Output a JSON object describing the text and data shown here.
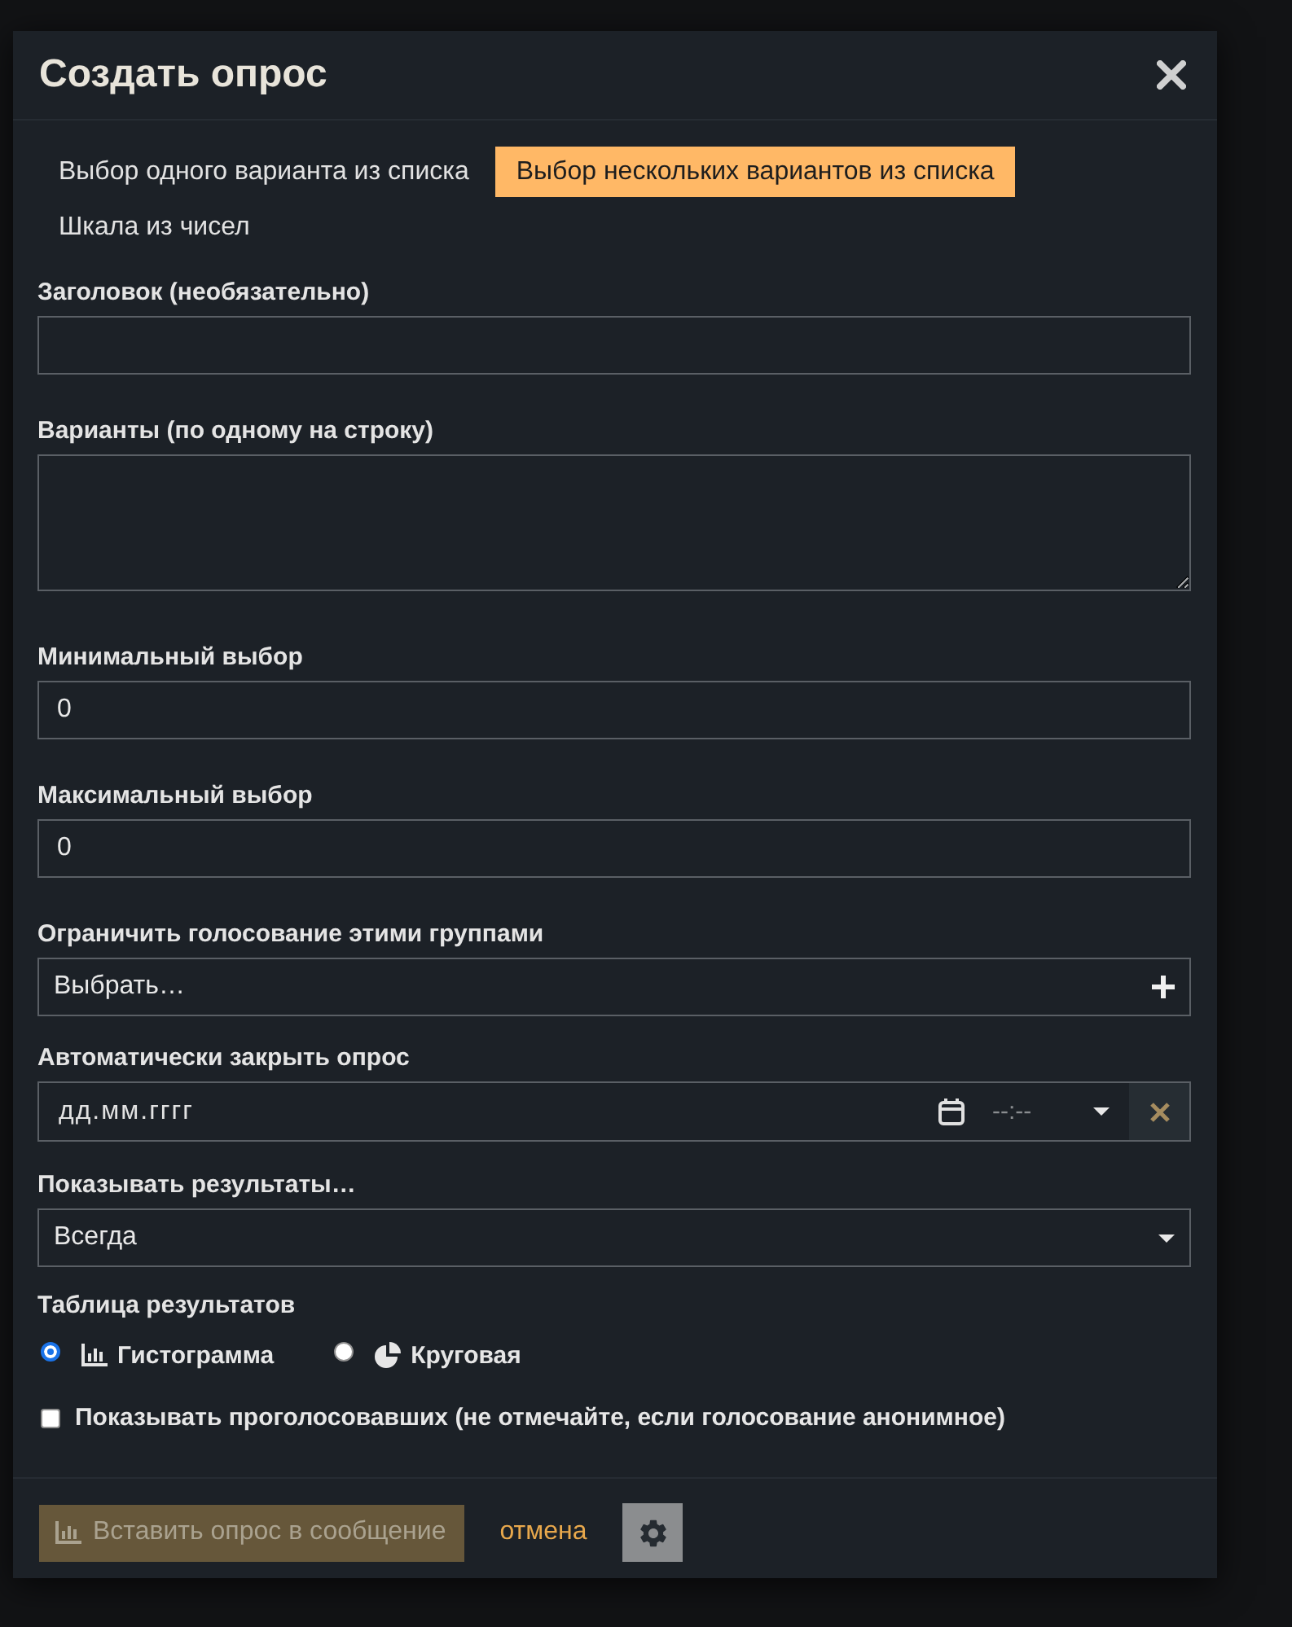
{
  "dialog": {
    "title": "Создать опрос"
  },
  "poll_types": [
    {
      "label": "Выбор одного варианта из списка",
      "selected": false
    },
    {
      "label": "Выбор нескольких вариантов из списка",
      "selected": true
    },
    {
      "label": "Шкала из чисел",
      "selected": false
    }
  ],
  "fields": [
    {
      "kind": "text",
      "label": "Заголовок (необязательно)"
    },
    {
      "kind": "textarea",
      "label": "Варианты (по одному на строку)"
    },
    {
      "kind": "number",
      "label": "Минимальный выбор",
      "value": "0"
    },
    {
      "kind": "number",
      "label": "Максимальный выбор",
      "value": "0"
    },
    {
      "kind": "picker",
      "label": "Ограничить голосование этими группами",
      "placeholder": "Выбрать…"
    },
    {
      "kind": "datetime",
      "label": "Автоматически закрыть опрос",
      "date": {
        "placeholder": "дд.мм.гггг"
      },
      "time": {
        "placeholder": "--:--"
      }
    },
    {
      "kind": "select",
      "label": "Показывать результаты…",
      "value": "Всегда"
    }
  ],
  "chart_type": {
    "label": "Таблица результатов",
    "options": [
      {
        "kind": "bar",
        "label": "Гистограмма",
        "selected": true
      },
      {
        "kind": "pie",
        "label": "Круговая",
        "selected": false
      }
    ]
  },
  "show_voters": {
    "label": "Показывать проголосовавших (не отмечайте, если голосование анонимное)",
    "checked": false
  },
  "footer": {
    "insert_button": {
      "label": "Вставить опрос в сообщение",
      "disabled": true
    },
    "cancel_link": "отмена"
  }
}
